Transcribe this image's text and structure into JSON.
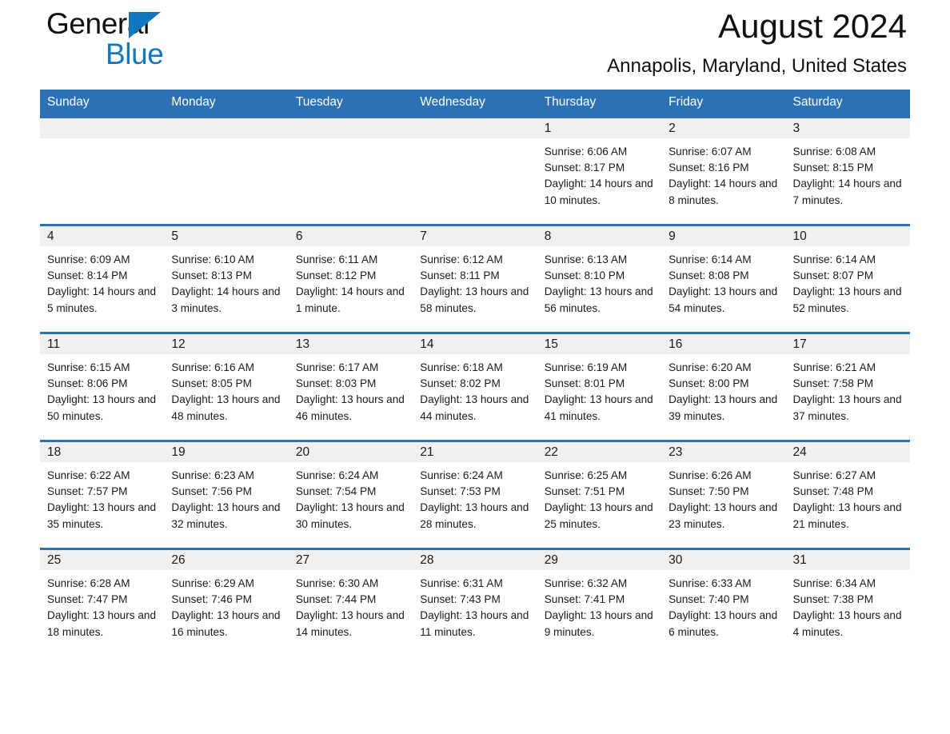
{
  "brand": {
    "name_part1": "General",
    "name_part2": "Blue",
    "accent_color": "#1277bf"
  },
  "header": {
    "title": "August 2024",
    "subtitle": "Annapolis, Maryland, United States",
    "header_bar_color": "#2c71b4",
    "daynum_band_color": "#f0f0f0"
  },
  "weekdays": [
    "Sunday",
    "Monday",
    "Tuesday",
    "Wednesday",
    "Thursday",
    "Friday",
    "Saturday"
  ],
  "weeks": [
    [
      {
        "day": "",
        "sunrise": "",
        "sunset": "",
        "daylight": "",
        "empty": true
      },
      {
        "day": "",
        "sunrise": "",
        "sunset": "",
        "daylight": "",
        "empty": true
      },
      {
        "day": "",
        "sunrise": "",
        "sunset": "",
        "daylight": "",
        "empty": true
      },
      {
        "day": "",
        "sunrise": "",
        "sunset": "",
        "daylight": "",
        "empty": true
      },
      {
        "day": "1",
        "sunrise": "Sunrise: 6:06 AM",
        "sunset": "Sunset: 8:17 PM",
        "daylight": "Daylight: 14 hours and 10 minutes."
      },
      {
        "day": "2",
        "sunrise": "Sunrise: 6:07 AM",
        "sunset": "Sunset: 8:16 PM",
        "daylight": "Daylight: 14 hours and 8 minutes."
      },
      {
        "day": "3",
        "sunrise": "Sunrise: 6:08 AM",
        "sunset": "Sunset: 8:15 PM",
        "daylight": "Daylight: 14 hours and 7 minutes."
      }
    ],
    [
      {
        "day": "4",
        "sunrise": "Sunrise: 6:09 AM",
        "sunset": "Sunset: 8:14 PM",
        "daylight": "Daylight: 14 hours and 5 minutes."
      },
      {
        "day": "5",
        "sunrise": "Sunrise: 6:10 AM",
        "sunset": "Sunset: 8:13 PM",
        "daylight": "Daylight: 14 hours and 3 minutes."
      },
      {
        "day": "6",
        "sunrise": "Sunrise: 6:11 AM",
        "sunset": "Sunset: 8:12 PM",
        "daylight": "Daylight: 14 hours and 1 minute."
      },
      {
        "day": "7",
        "sunrise": "Sunrise: 6:12 AM",
        "sunset": "Sunset: 8:11 PM",
        "daylight": "Daylight: 13 hours and 58 minutes."
      },
      {
        "day": "8",
        "sunrise": "Sunrise: 6:13 AM",
        "sunset": "Sunset: 8:10 PM",
        "daylight": "Daylight: 13 hours and 56 minutes."
      },
      {
        "day": "9",
        "sunrise": "Sunrise: 6:14 AM",
        "sunset": "Sunset: 8:08 PM",
        "daylight": "Daylight: 13 hours and 54 minutes."
      },
      {
        "day": "10",
        "sunrise": "Sunrise: 6:14 AM",
        "sunset": "Sunset: 8:07 PM",
        "daylight": "Daylight: 13 hours and 52 minutes."
      }
    ],
    [
      {
        "day": "11",
        "sunrise": "Sunrise: 6:15 AM",
        "sunset": "Sunset: 8:06 PM",
        "daylight": "Daylight: 13 hours and 50 minutes."
      },
      {
        "day": "12",
        "sunrise": "Sunrise: 6:16 AM",
        "sunset": "Sunset: 8:05 PM",
        "daylight": "Daylight: 13 hours and 48 minutes."
      },
      {
        "day": "13",
        "sunrise": "Sunrise: 6:17 AM",
        "sunset": "Sunset: 8:03 PM",
        "daylight": "Daylight: 13 hours and 46 minutes."
      },
      {
        "day": "14",
        "sunrise": "Sunrise: 6:18 AM",
        "sunset": "Sunset: 8:02 PM",
        "daylight": "Daylight: 13 hours and 44 minutes."
      },
      {
        "day": "15",
        "sunrise": "Sunrise: 6:19 AM",
        "sunset": "Sunset: 8:01 PM",
        "daylight": "Daylight: 13 hours and 41 minutes."
      },
      {
        "day": "16",
        "sunrise": "Sunrise: 6:20 AM",
        "sunset": "Sunset: 8:00 PM",
        "daylight": "Daylight: 13 hours and 39 minutes."
      },
      {
        "day": "17",
        "sunrise": "Sunrise: 6:21 AM",
        "sunset": "Sunset: 7:58 PM",
        "daylight": "Daylight: 13 hours and 37 minutes."
      }
    ],
    [
      {
        "day": "18",
        "sunrise": "Sunrise: 6:22 AM",
        "sunset": "Sunset: 7:57 PM",
        "daylight": "Daylight: 13 hours and 35 minutes."
      },
      {
        "day": "19",
        "sunrise": "Sunrise: 6:23 AM",
        "sunset": "Sunset: 7:56 PM",
        "daylight": "Daylight: 13 hours and 32 minutes."
      },
      {
        "day": "20",
        "sunrise": "Sunrise: 6:24 AM",
        "sunset": "Sunset: 7:54 PM",
        "daylight": "Daylight: 13 hours and 30 minutes."
      },
      {
        "day": "21",
        "sunrise": "Sunrise: 6:24 AM",
        "sunset": "Sunset: 7:53 PM",
        "daylight": "Daylight: 13 hours and 28 minutes."
      },
      {
        "day": "22",
        "sunrise": "Sunrise: 6:25 AM",
        "sunset": "Sunset: 7:51 PM",
        "daylight": "Daylight: 13 hours and 25 minutes."
      },
      {
        "day": "23",
        "sunrise": "Sunrise: 6:26 AM",
        "sunset": "Sunset: 7:50 PM",
        "daylight": "Daylight: 13 hours and 23 minutes."
      },
      {
        "day": "24",
        "sunrise": "Sunrise: 6:27 AM",
        "sunset": "Sunset: 7:48 PM",
        "daylight": "Daylight: 13 hours and 21 minutes."
      }
    ],
    [
      {
        "day": "25",
        "sunrise": "Sunrise: 6:28 AM",
        "sunset": "Sunset: 7:47 PM",
        "daylight": "Daylight: 13 hours and 18 minutes."
      },
      {
        "day": "26",
        "sunrise": "Sunrise: 6:29 AM",
        "sunset": "Sunset: 7:46 PM",
        "daylight": "Daylight: 13 hours and 16 minutes."
      },
      {
        "day": "27",
        "sunrise": "Sunrise: 6:30 AM",
        "sunset": "Sunset: 7:44 PM",
        "daylight": "Daylight: 13 hours and 14 minutes."
      },
      {
        "day": "28",
        "sunrise": "Sunrise: 6:31 AM",
        "sunset": "Sunset: 7:43 PM",
        "daylight": "Daylight: 13 hours and 11 minutes."
      },
      {
        "day": "29",
        "sunrise": "Sunrise: 6:32 AM",
        "sunset": "Sunset: 7:41 PM",
        "daylight": "Daylight: 13 hours and 9 minutes."
      },
      {
        "day": "30",
        "sunrise": "Sunrise: 6:33 AM",
        "sunset": "Sunset: 7:40 PM",
        "daylight": "Daylight: 13 hours and 6 minutes."
      },
      {
        "day": "31",
        "sunrise": "Sunrise: 6:34 AM",
        "sunset": "Sunset: 7:38 PM",
        "daylight": "Daylight: 13 hours and 4 minutes."
      }
    ]
  ]
}
